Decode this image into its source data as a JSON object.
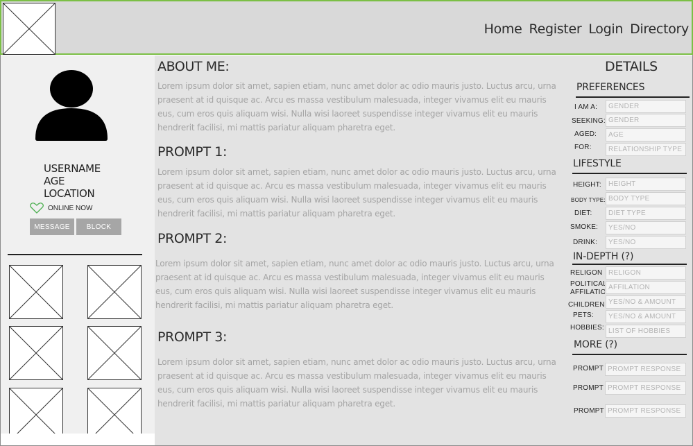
{
  "nav": {
    "items": [
      "Home",
      "Register",
      "Login",
      "Directory"
    ]
  },
  "profile": {
    "username": "USERNAME",
    "age": "AGE",
    "location": "LOCATION",
    "online_status": "ONLINE NOW",
    "message_label": "MESSAGE",
    "block_label": "BLOCK"
  },
  "main": {
    "sections": [
      {
        "title": "ABOUT ME:",
        "body": "Lorem ipsum dolor sit amet, sapien etiam, nunc amet dolor ac odio mauris justo. Luctus arcu, urna praesent at id quisque ac. Arcu es massa vestibulum malesuada, integer vivamus elit eu mauris eus, cum eros quis aliquam wisi. Nulla wisi laoreet suspendisse integer vivamus elit eu mauris hendrerit facilisi, mi mattis pariatur aliquam pharetra eget."
      },
      {
        "title": "PROMPT 1:",
        "body": "Lorem ipsum dolor sit amet, sapien etiam, nunc amet dolor ac odio mauris justo. Luctus arcu, urna praesent at id quisque ac. Arcu es massa vestibulum malesuada, integer vivamus elit eu mauris eus, cum eros quis aliquam wisi. Nulla wisi laoreet suspendisse integer vivamus elit eu mauris hendrerit facilisi, mi mattis pariatur aliquam pharetra eget."
      },
      {
        "title": "PROMPT 2:",
        "body": "Lorem ipsum dolor sit amet, sapien etiam, nunc amet dolor ac odio mauris justo. Luctus arcu, urna praesent at id quisque ac. Arcu es massa vestibulum malesuada, integer vivamus elit eu mauris eus, cum eros quis aliquam wisi. Nulla wisi laoreet suspendisse integer vivamus elit eu mauris hendrerit facilisi, mi mattis pariatur aliquam pharetra eget."
      },
      {
        "title": "PROMPT 3:",
        "body": "Lorem ipsum dolor sit amet, sapien etiam, nunc amet dolor ac odio mauris justo. Luctus arcu, urna praesent at id quisque ac. Arcu es massa vestibulum malesuada, integer vivamus elit eu mauris eus, cum eros quis aliquam wisi. Nulla wisi laoreet suspendisse integer vivamus elit eu mauris hendrerit facilisi, mi mattis pariatur aliquam pharetra eget."
      }
    ]
  },
  "details": {
    "title": "DETAILS",
    "preferences": {
      "title": "PREFERENCES",
      "rows": [
        {
          "label": "I AM A:",
          "placeholder": "GENDER"
        },
        {
          "label": "SEEKING:",
          "placeholder": "GENDER"
        },
        {
          "label": "AGED:",
          "placeholder": "AGE"
        },
        {
          "label": "FOR:",
          "placeholder": "RELATIONSHIP TYPE"
        }
      ]
    },
    "lifestyle": {
      "title": "LIFESTYLE",
      "rows": [
        {
          "label": "HEIGHT:",
          "placeholder": "HEIGHT"
        },
        {
          "label": "BODY TYPE:",
          "placeholder": "BODY TYPE"
        },
        {
          "label": "DIET:",
          "placeholder": "DIET TYPE"
        },
        {
          "label": "SMOKE:",
          "placeholder": "YES/NO"
        },
        {
          "label": "DRINK:",
          "placeholder": "YES/NO"
        }
      ]
    },
    "in_depth": {
      "title": "IN-DEPTH (?)",
      "rows": [
        {
          "label": "RELIGON",
          "placeholder": "RELIGON"
        },
        {
          "label": "POLITICAL AFFILATIO",
          "placeholder": "AFFILATION"
        },
        {
          "label": "CHILDREN",
          "placeholder": "YES/NO & AMOUNT"
        },
        {
          "label": "PETS:",
          "placeholder": "YES/NO & AMOUNT"
        },
        {
          "label": "HOBBIES:",
          "placeholder": "LIST OF HOBBIES"
        }
      ]
    },
    "more": {
      "title": "MORE (?)",
      "rows": [
        {
          "label": "PROMPT",
          "placeholder": "PROMPT RESPONSE"
        },
        {
          "label": "PROMPT",
          "placeholder": "PROMPT RESPONSE"
        },
        {
          "label": "PROMPT",
          "placeholder": "PROMPT RESPONSE"
        }
      ]
    }
  }
}
